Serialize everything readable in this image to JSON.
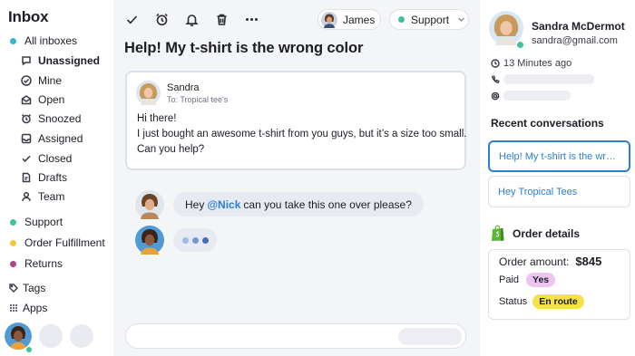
{
  "sidebar": {
    "title": "Inbox",
    "all_inboxes": {
      "label": "All inboxes",
      "color": "#35b6d4"
    },
    "sub_items": [
      {
        "label": "Unassigned",
        "icon": "speech-bubble-icon",
        "bold": true
      },
      {
        "label": "Mine",
        "icon": "check-circle-icon"
      },
      {
        "label": "Open",
        "icon": "open-envelope-icon"
      },
      {
        "label": "Snoozed",
        "icon": "alarm-clock-icon"
      },
      {
        "label": "Assigned",
        "icon": "inbox-tray-icon"
      },
      {
        "label": "Closed",
        "icon": "checkmark-icon"
      },
      {
        "label": "Drafts",
        "icon": "draft-document-icon"
      },
      {
        "label": "Team",
        "icon": "person-icon"
      }
    ],
    "inboxes": [
      {
        "label": "Support",
        "color": "#3ec29a"
      },
      {
        "label": "Order Fulfillment",
        "color": "#f0c93c"
      },
      {
        "label": "Returns",
        "color": "#b0458b"
      }
    ],
    "tags_label": "Tags",
    "apps_label": "Apps"
  },
  "toolbar": {
    "icons": [
      "checkmark-icon",
      "alarm-clock-icon",
      "bell-icon",
      "trash-icon",
      "more-dots-icon"
    ],
    "assignee": "James",
    "inbox_select": "Support",
    "inbox_color": "#3ec29a"
  },
  "conversation": {
    "subject": "Help! My t-shirt is the wrong color",
    "message": {
      "from": "Sandra",
      "to": "To: Tropical tee's",
      "lines": [
        "Hi there!",
        "I just bought an awesome t-shirt from you guys, but it’s a size too small.",
        "Can you help?"
      ]
    },
    "comment": {
      "before": "Hey",
      "mention": "@Nick",
      "after": "can you take this one over please?"
    },
    "typing_dot_colors": [
      "#9db9e6",
      "#6f97d8",
      "#3f6fc0"
    ]
  },
  "contact": {
    "name": "Sandra McDermot",
    "email": "sandra@gmail.com",
    "last_seen": "13 Minutes ago",
    "online_color": "#3ec29a"
  },
  "recent": {
    "title": "Recent conversations",
    "items": [
      {
        "label": "Help! My t-shirt is the wr…",
        "active": true
      },
      {
        "label": "Hey Tropical Tees",
        "active": false
      }
    ]
  },
  "order": {
    "title": "Order details",
    "amount_label": "Order amount:",
    "amount_value": "$845",
    "paid_label": "Paid",
    "paid_value": "Yes",
    "status_label": "Status",
    "status_value": "En route",
    "colors": {
      "accent": "#2c7fd8",
      "paid_badge": "#ecc4f0",
      "status_badge": "#f5e24a",
      "shopify": "#5fb43b"
    }
  }
}
